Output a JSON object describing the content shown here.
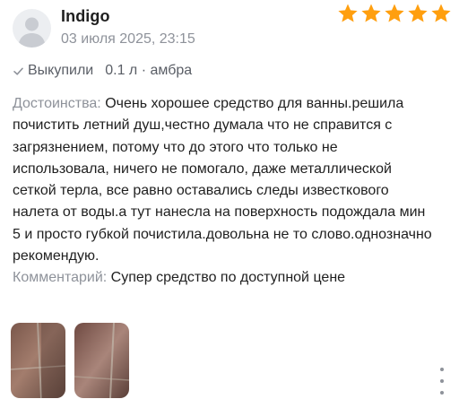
{
  "review": {
    "author": "Indigo",
    "date": "03 июля 2025, 23:15",
    "rating": 5,
    "rating_max": 5,
    "purchase_status": "Выкупили",
    "variant": "0.1 л · амбра",
    "pros_label": "Достоинства:",
    "pros_text": "Очень хорошее средство для ванны.решила почистить летний душ,честно думала что не справится с загрязнением, потому что до этого что только не использовала, ничего не помогало, даже металлической сеткой терла, все равно оставались следы известкового налета от воды.а тут нанесла на поверхность подождала мин 5 и просто губкой почистила.довольна не то слово.однозначно рекомендую.",
    "comment_label": "Комментарий:",
    "comment_text": "Супер средство по доступной цене",
    "photos": [
      "photo-1",
      "photo-2"
    ]
  },
  "colors": {
    "star": "#ff9f0f",
    "muted": "#8e929a",
    "text": "#1f1f1f",
    "avatar_bg": "#eceef1"
  },
  "icons": {
    "avatar": "user-silhouette-icon",
    "star": "star-icon",
    "check": "check-icon",
    "menu": "more-vertical-icon"
  }
}
